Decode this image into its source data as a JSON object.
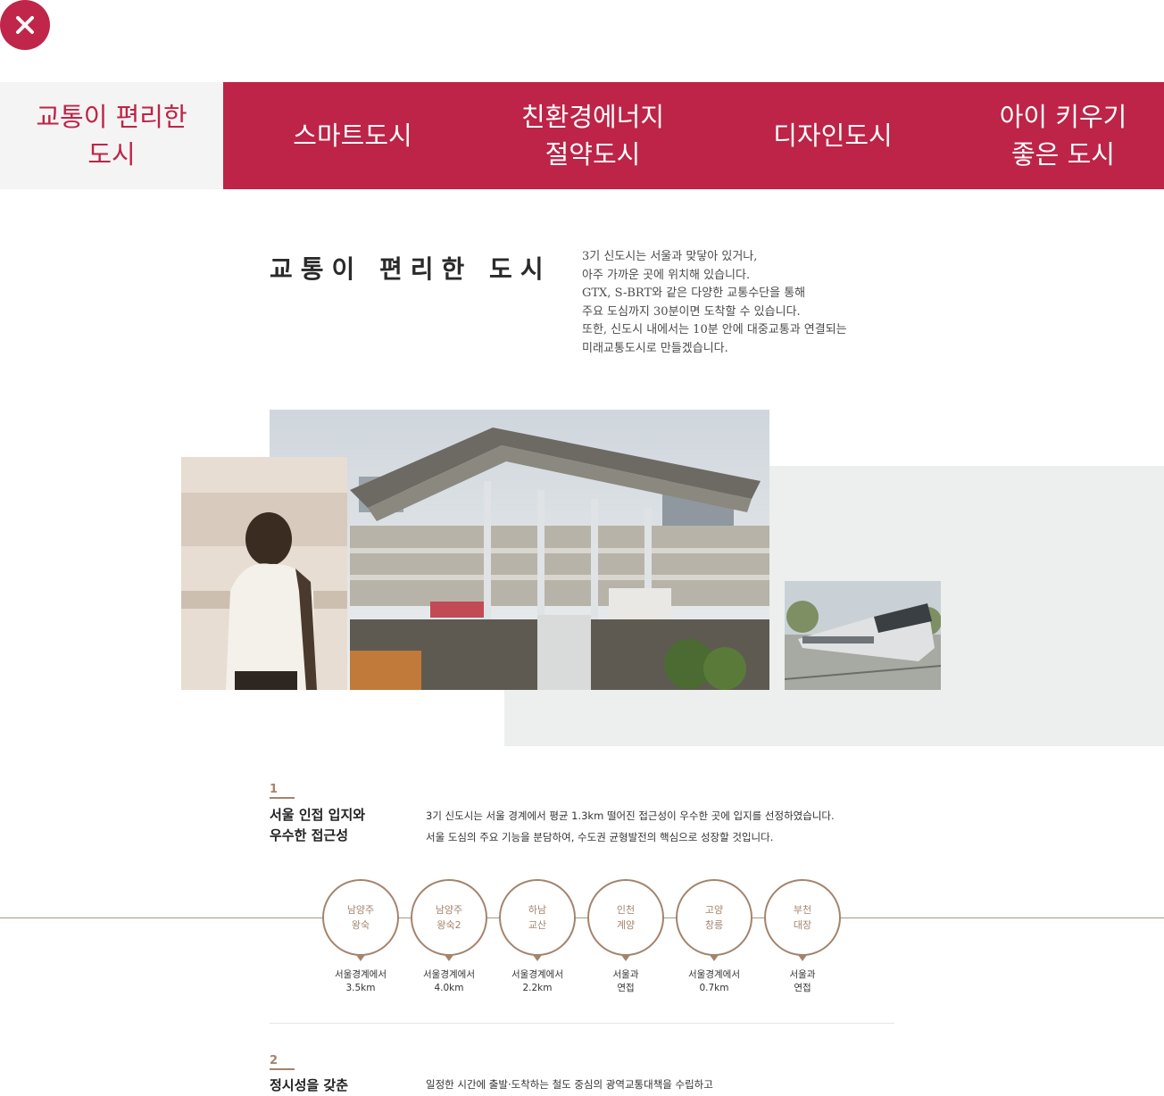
{
  "tabs": [
    {
      "line1": "교통이 편리한",
      "line2": "도시",
      "active": true
    },
    {
      "line1": "스마트도시",
      "line2": "",
      "active": false
    },
    {
      "line1": "친환경에너지",
      "line2": "절약도시",
      "active": false
    },
    {
      "line1": "디자인도시",
      "line2": "",
      "active": false
    },
    {
      "line1": "아이 키우기",
      "line2": "좋은 도시",
      "active": false
    }
  ],
  "section": {
    "title": "교통이 편리한 도시",
    "intro": [
      "3기 신도시는 서울과 맞닿아 있거나,",
      "아주 가까운 곳에 위치해 있습니다.",
      "GTX, S-BRT와 같은 다양한 교통수단을 통해",
      "주요 도심까지 30분이면 도착할 수 있습니다.",
      "또한, 신도시 내에서는 10분 안에 대중교통과 연결되는",
      "미래교통도시로 만들겠습니다."
    ]
  },
  "items": [
    {
      "number": "1",
      "heading_line1": "서울 인접 입지와",
      "heading_line2": "우수한 접근성",
      "desc_line1": "3기 신도시는 서울 경계에서 평균 1.3km 떨어진 접근성이 우수한 곳에 입지를 선정하였습니다.",
      "desc_line2": "서울 도심의 주요 기능을 분담하여, 수도권 균형발전의 핵심으로 성장할 것입니다."
    },
    {
      "number": "2",
      "heading_line1": "정시성을 갖춘",
      "desc_line1": "일정한 시간에 출발·도착하는 철도 중심의 광역교통대책을 수립하고"
    }
  ],
  "cities": [
    {
      "name1": "남양주",
      "name2": "왕숙",
      "info1": "서울경계에서",
      "info2": "3.5km"
    },
    {
      "name1": "남양주",
      "name2": "왕숙2",
      "info1": "서울경계에서",
      "info2": "4.0km"
    },
    {
      "name1": "하남",
      "name2": "교산",
      "info1": "서울경계에서",
      "info2": "2.2km"
    },
    {
      "name1": "인천",
      "name2": "계양",
      "info1": "서울과",
      "info2": "연접"
    },
    {
      "name1": "고양",
      "name2": "창릉",
      "info1": "서울경계에서",
      "info2": "0.7km"
    },
    {
      "name1": "부천",
      "name2": "대장",
      "info1": "서울과",
      "info2": "연접"
    }
  ],
  "colors": {
    "accent": "#bd2447",
    "brown": "#a3846d",
    "panel": "#ecefee"
  },
  "icons": {
    "close": "close-icon"
  }
}
